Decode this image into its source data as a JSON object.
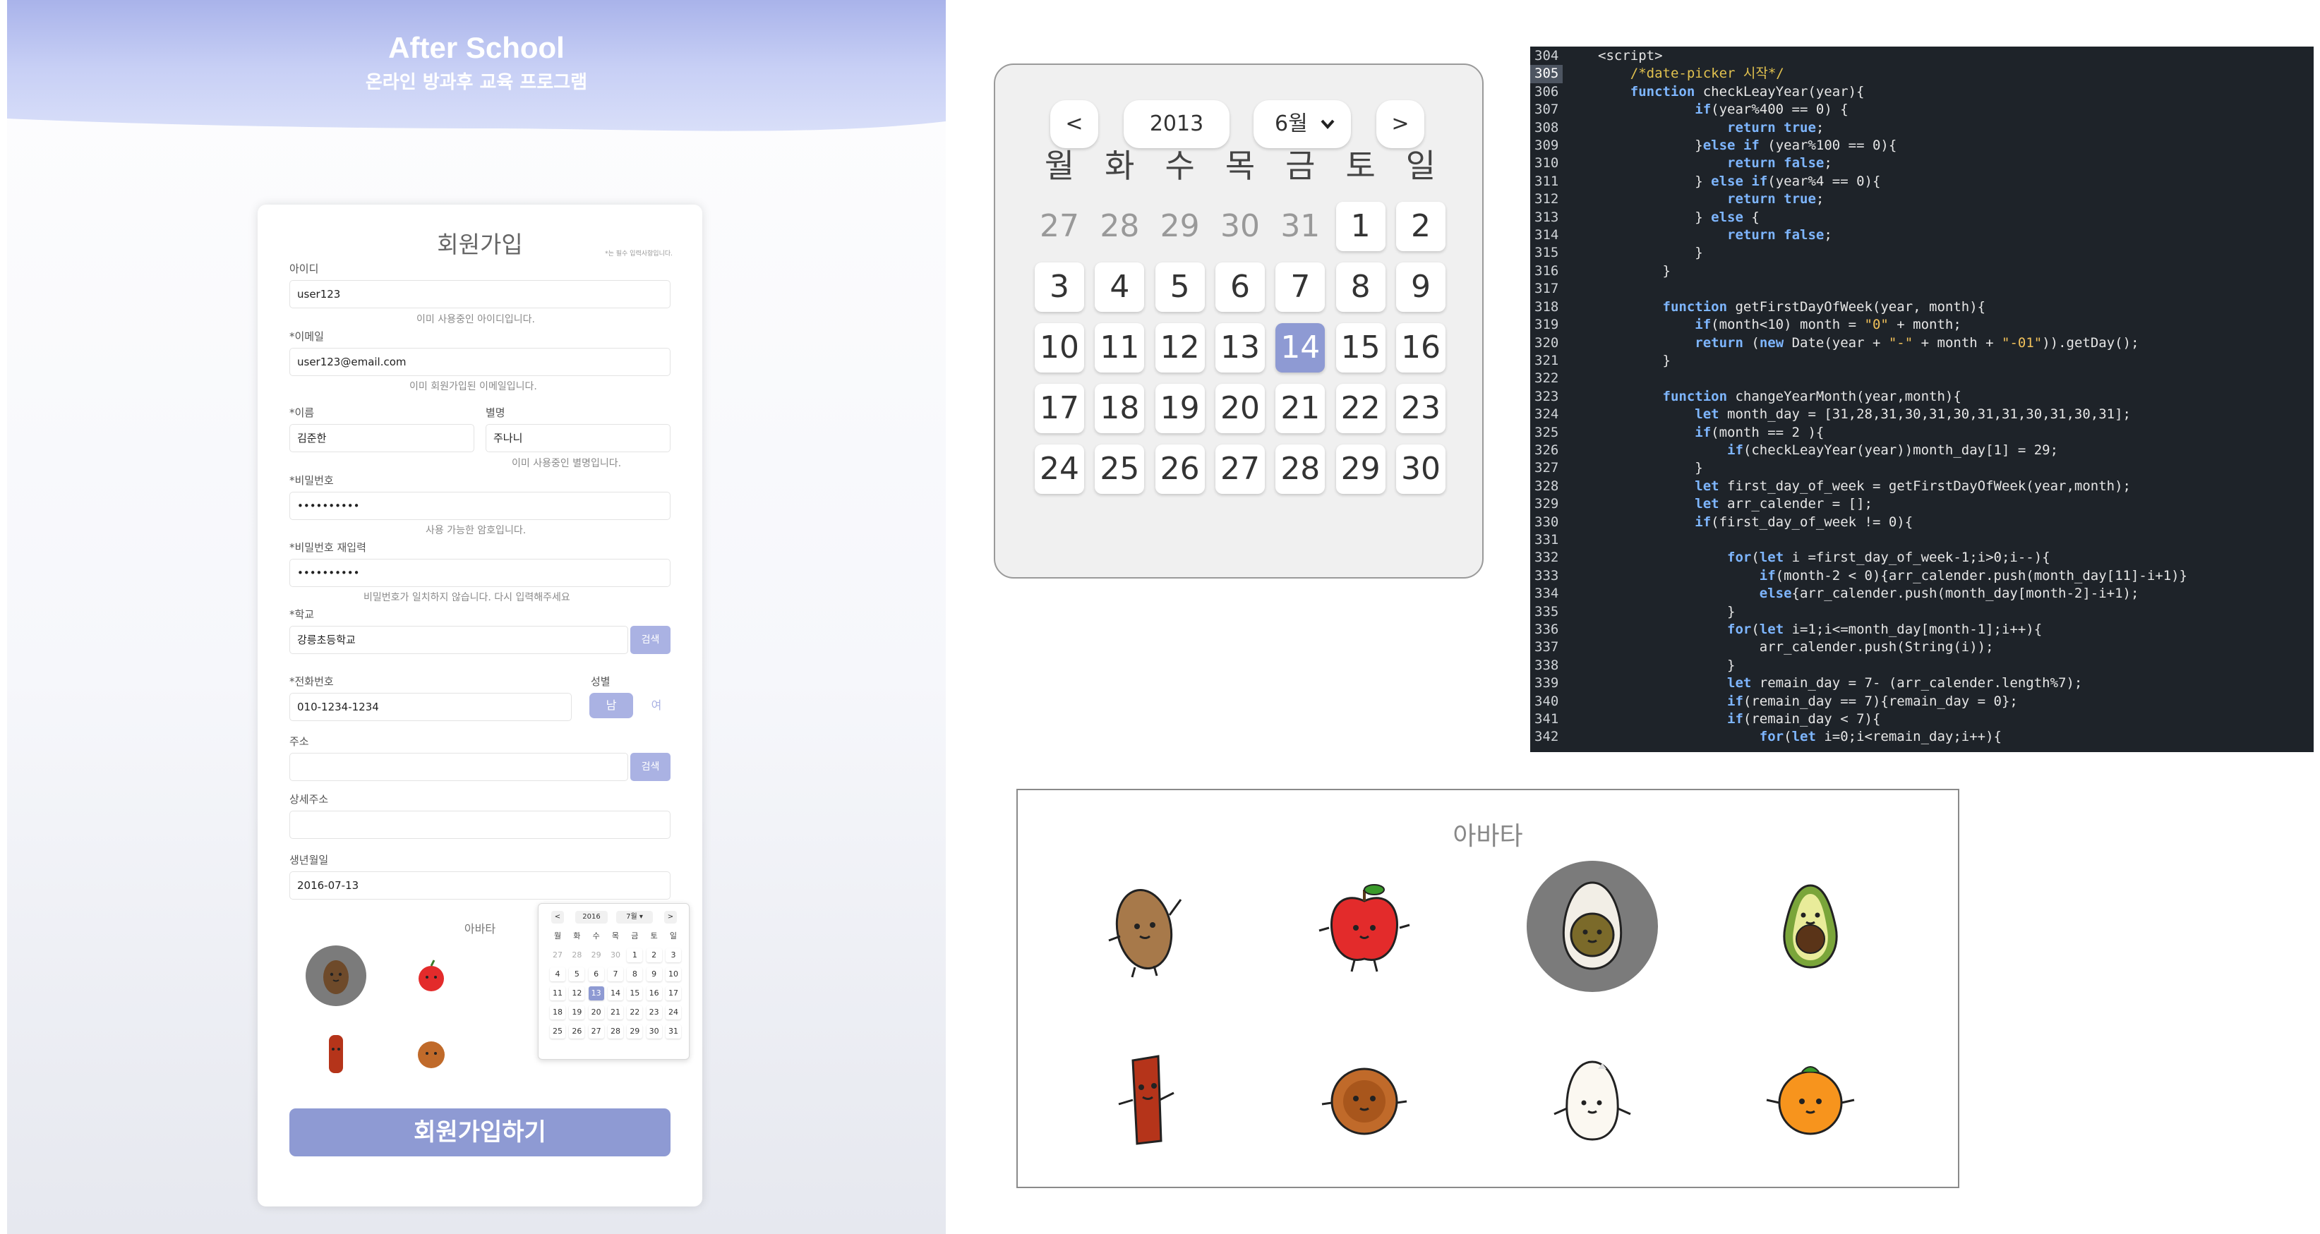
{
  "hero": {
    "title": "After School",
    "subtitle": "온라인 방과후 교육 프로그램"
  },
  "signup": {
    "title": "회원가입",
    "required_note": "*는 필수 입력사항입니다.",
    "id_label": "아이디",
    "id_value": "user123",
    "id_msg": "이미 사용중인 아이디입니다.",
    "email_label": "*이메일",
    "email_value": "user123@email.com",
    "email_msg": "이미 회원가입된 이메일입니다.",
    "name_label": "*이름",
    "name_value": "김준한",
    "nick_label": "별명",
    "nick_value": "주나니",
    "nick_msg": "이미 사용중인 별명입니다.",
    "pw_label": "*비밀번호",
    "pw_value": "••••••••••",
    "pw_msg": "사용 가능한 암호입니다.",
    "pw2_label": "*비밀번호 재입력",
    "pw2_value": "••••••••••",
    "pw2_msg": "비밀번호가 일치하지 않습니다. 다시 입력해주세요",
    "school_label": "*학교",
    "school_value": "강릉초등학교",
    "school_search": "검색",
    "phone_label": "*전화번호",
    "phone_value": "010-1234-1234",
    "gender_label": "성별",
    "gender_male": "남",
    "gender_female": "여",
    "addr_label": "주소",
    "addr_value": "",
    "addr_search": "검색",
    "addr2_label": "상세주소",
    "addr2_value": "",
    "birth_label": "생년월일",
    "birth_value": "2016-07-13",
    "avatar_label": "아바타",
    "submit": "회원가입하기"
  },
  "mini_picker": {
    "prev": "<",
    "year": "2016",
    "month": "7월 ▾",
    "next": ">",
    "weekdays": [
      "월",
      "화",
      "수",
      "목",
      "금",
      "토",
      "일"
    ],
    "weeks": [
      [
        "27",
        "28",
        "29",
        "30",
        "1",
        "2",
        "3"
      ],
      [
        "4",
        "5",
        "6",
        "7",
        "8",
        "9",
        "10"
      ],
      [
        "11",
        "12",
        "13",
        "14",
        "15",
        "16",
        "17"
      ],
      [
        "18",
        "19",
        "20",
        "21",
        "22",
        "23",
        "24"
      ],
      [
        "25",
        "26",
        "27",
        "28",
        "29",
        "30",
        "31"
      ]
    ],
    "selected": "13"
  },
  "date_picker": {
    "prev": "<",
    "year": "2013",
    "month": "6월",
    "next": ">",
    "weekdays": [
      "월",
      "화",
      "수",
      "목",
      "금",
      "토",
      "일"
    ],
    "weeks": [
      [
        "27",
        "28",
        "29",
        "30",
        "31",
        "1",
        "2"
      ],
      [
        "3",
        "4",
        "5",
        "6",
        "7",
        "8",
        "9"
      ],
      [
        "10",
        "11",
        "12",
        "13",
        "14",
        "15",
        "16"
      ],
      [
        "17",
        "18",
        "19",
        "20",
        "21",
        "22",
        "23"
      ],
      [
        "24",
        "25",
        "26",
        "27",
        "28",
        "29",
        "30"
      ]
    ],
    "selected": "14"
  },
  "code": {
    "lines": [
      {
        "n": "304",
        "t": "<script>"
      },
      {
        "n": "305",
        "t": "    /*date-picker 시작*/"
      },
      {
        "n": "306",
        "t": "    function checkLeayYear(year){"
      },
      {
        "n": "307",
        "t": "            if(year%400 == 0) {"
      },
      {
        "n": "308",
        "t": "                return true;"
      },
      {
        "n": "309",
        "t": "            }else if (year%100 == 0){"
      },
      {
        "n": "310",
        "t": "                return false;"
      },
      {
        "n": "311",
        "t": "            } else if(year%4 == 0){"
      },
      {
        "n": "312",
        "t": "                return true;"
      },
      {
        "n": "313",
        "t": "            } else {"
      },
      {
        "n": "314",
        "t": "                return false;"
      },
      {
        "n": "315",
        "t": "            }"
      },
      {
        "n": "316",
        "t": "        }"
      },
      {
        "n": "317",
        "t": ""
      },
      {
        "n": "318",
        "t": "        function getFirstDayOfWeek(year, month){"
      },
      {
        "n": "319",
        "t": "            if(month<10) month = \"0\" + month;"
      },
      {
        "n": "320",
        "t": "            return (new Date(year + \"-\" + month + \"-01\")).getDay();"
      },
      {
        "n": "321",
        "t": "        }"
      },
      {
        "n": "322",
        "t": ""
      },
      {
        "n": "323",
        "t": "        function changeYearMonth(year,month){"
      },
      {
        "n": "324",
        "t": "            let month_day = [31,28,31,30,31,30,31,31,30,31,30,31];"
      },
      {
        "n": "325",
        "t": "            if(month == 2 ){"
      },
      {
        "n": "326",
        "t": "                if(checkLeayYear(year))month_day[1] = 29;"
      },
      {
        "n": "327",
        "t": "            }"
      },
      {
        "n": "328",
        "t": "            let first_day_of_week = getFirstDayOfWeek(year,month);"
      },
      {
        "n": "329",
        "t": "            let arr_calender = [];"
      },
      {
        "n": "330",
        "t": "            if(first_day_of_week != 0){"
      },
      {
        "n": "331",
        "t": ""
      },
      {
        "n": "332",
        "t": "                for(let i =first_day_of_week-1;i>0;i--){"
      },
      {
        "n": "333",
        "t": "                    if(month-2 < 0){arr_calender.push(month_day[11]-i+1)}"
      },
      {
        "n": "334",
        "t": "                    else{arr_calender.push(month_day[month-2]-i+1);"
      },
      {
        "n": "335",
        "t": "                }"
      },
      {
        "n": "336",
        "t": "                for(let i=1;i<=month_day[month-1];i++){"
      },
      {
        "n": "337",
        "t": "                    arr_calender.push(String(i));"
      },
      {
        "n": "338",
        "t": "                }"
      },
      {
        "n": "339",
        "t": "                let remain_day = 7- (arr_calender.length%7);"
      },
      {
        "n": "340",
        "t": "                if(remain_day == 7){remain_day = 0};"
      },
      {
        "n": "341",
        "t": "                if(remain_day < 7){"
      },
      {
        "n": "342",
        "t": "                    for(let i=0;i<remain_day;i++){"
      }
    ]
  },
  "avatars": {
    "title": "아바타",
    "items": [
      "potato-avatar",
      "apple-avatar",
      "egg-avatar",
      "avocado-avatar",
      "sausage-avatar",
      "yakgwa-avatar",
      "rice-avatar",
      "tangerine-avatar"
    ],
    "selected": "egg-avatar"
  }
}
